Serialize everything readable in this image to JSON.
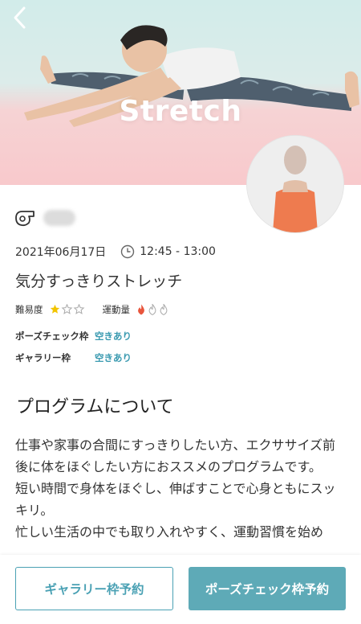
{
  "hero": {
    "title": "Stretch",
    "back_icon": "chevron-left-icon"
  },
  "instructor": {
    "icon": "whistle-icon",
    "name": "講師"
  },
  "lesson": {
    "date": "2021年06月17日",
    "time": "12:45 - 13:00",
    "title": "気分すっきりストレッチ",
    "difficulty_label": "難易度",
    "difficulty_rating": 1,
    "difficulty_max": 3,
    "intensity_label": "運動量",
    "intensity_rating": 1,
    "intensity_max": 3
  },
  "slots": {
    "pose_label": "ポーズチェック枠",
    "pose_value": "空きあり",
    "gallery_label": "ギャラリー枠",
    "gallery_value": "空きあり"
  },
  "about": {
    "heading": "プログラムについて",
    "text": "仕事や家事の合間にすっきりしたい方、エクササイズ前後に体をほぐしたい方におススメのプログラムです。\n短い時間で身体をほぐし、伸ばすことで心身ともにスッキリ。\n忙しい生活の中でも取り入れやすく、運動習慣を始め"
  },
  "actions": {
    "gallery_button": "ギャラリー枠予約",
    "pose_button": "ポーズチェック枠予約"
  },
  "colors": {
    "accent": "#5eaab7",
    "link": "#3a9ab0",
    "star": "#f2c400",
    "flame": "#e8553c"
  }
}
